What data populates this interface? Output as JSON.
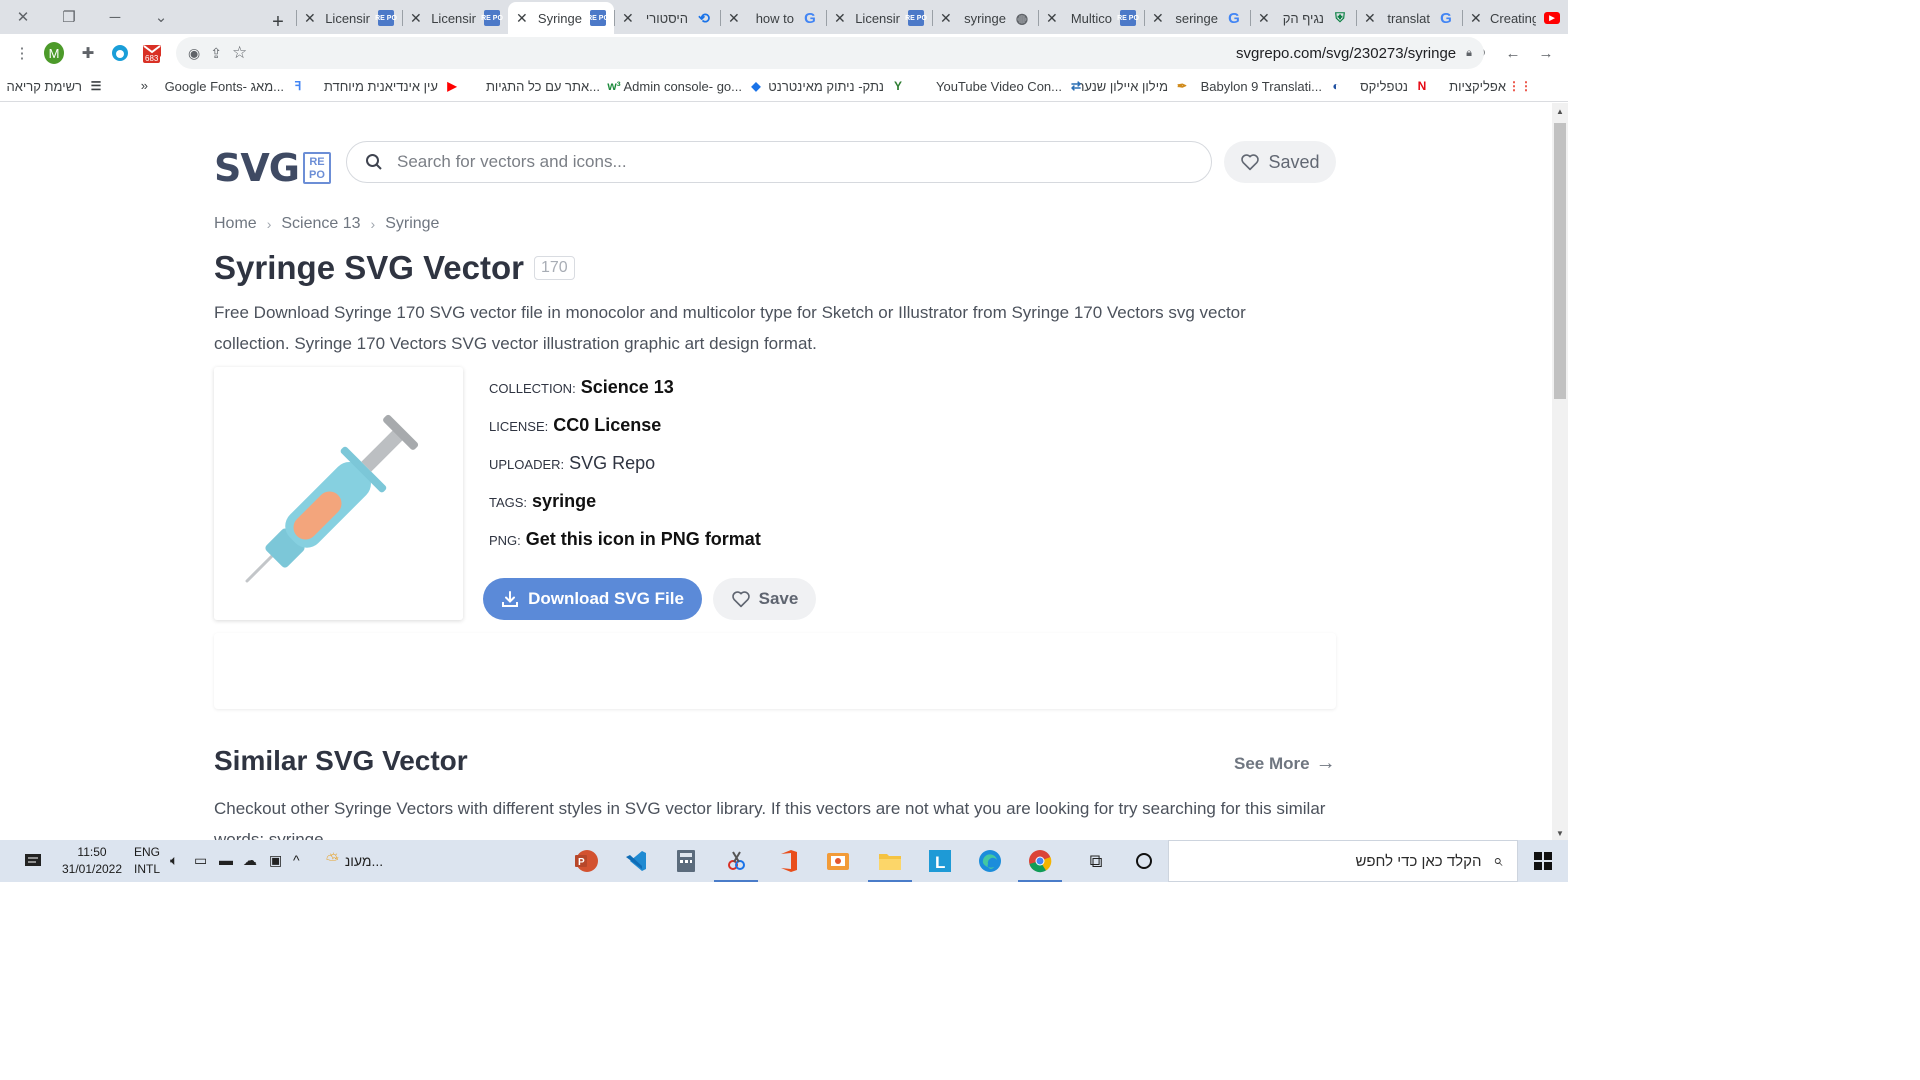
{
  "browser": {
    "tabs": [
      {
        "title": "Creating",
        "icon": "youtube-icon",
        "active": false
      },
      {
        "title": "translat",
        "icon": "google-icon",
        "active": false
      },
      {
        "title": "נגיף הק",
        "icon": "shield-icon",
        "active": false
      },
      {
        "title": "seringe",
        "icon": "google-icon",
        "active": false
      },
      {
        "title": "Multico",
        "icon": "svgrepo-icon",
        "active": false
      },
      {
        "title": "syringe",
        "icon": "globe-icon",
        "active": false
      },
      {
        "title": "Licensir",
        "icon": "svgrepo-icon",
        "active": false
      },
      {
        "title": "how to",
        "icon": "google-icon",
        "active": false
      },
      {
        "title": "היסטורי",
        "icon": "history-icon",
        "active": false
      },
      {
        "title": "Syringe",
        "icon": "svgrepo-icon",
        "active": true
      },
      {
        "title": "Licensir",
        "icon": "svgrepo-icon",
        "active": false
      },
      {
        "title": "Licensir",
        "icon": "svgrepo-icon",
        "active": false
      }
    ],
    "url": "svgrepo.com/svg/230273/syringe",
    "gmail_badge": "683",
    "profile_initial": "M",
    "bookmarks": [
      {
        "label": "אפליקציות",
        "icon": "apps-grid-icon"
      },
      {
        "label": "נטפליקס",
        "icon": "netflix-icon"
      },
      {
        "label": "Babylon 9 Translati...",
        "icon": "babylon-icon"
      },
      {
        "label": "מילון איילון שנער",
        "icon": "feather-icon"
      },
      {
        "label": "YouTube Video Con...",
        "icon": "converter-icon"
      },
      {
        "label": "נתק- ניתוק מאינטרנט",
        "icon": "plug-icon"
      },
      {
        "label": "Admin console- go...",
        "icon": "admin-icon"
      },
      {
        "label": "אתר עם כל התגיות...",
        "icon": "w3-icon"
      },
      {
        "label": "עין אינדיאנית מיוחדת",
        "icon": "youtube-icon"
      },
      {
        "label": "Google Fonts- מאג...",
        "icon": "fonts-icon"
      },
      {
        "label": "»",
        "icon": ""
      },
      {
        "label": "רשימת קריאה",
        "icon": "reading-list-icon"
      }
    ]
  },
  "site": {
    "logo_text": "SVG",
    "logo_badge": "RE PO",
    "search_placeholder": "Search for vectors and icons...",
    "saved_label": "Saved"
  },
  "breadcrumb": [
    "Home",
    "Science 13",
    "Syringe"
  ],
  "page": {
    "title": "Syringe SVG Vector",
    "count": "170",
    "description": "Free Download Syringe 170 SVG vector file in monocolor and multicolor type for Sketch or Illustrator from Syringe 170 Vectors svg vector collection. Syringe 170 Vectors SVG vector illustration graphic art design format."
  },
  "meta": {
    "collection_label": "COLLECTION:",
    "collection_value": "Science 13",
    "license_label": "LICENSE:",
    "license_value": "CC0 License",
    "uploader_label": "UPLOADER:",
    "uploader_value": "SVG Repo",
    "tags_label": "TAGS:",
    "tags_value": "syringe",
    "png_label": "PNG:",
    "png_value": "Get this icon in PNG format"
  },
  "actions": {
    "download_label": "Download SVG File",
    "save_label": "Save"
  },
  "similar": {
    "heading": "Similar SVG Vector",
    "see_more": "See More",
    "text": "Checkout other Syringe Vectors with different styles in SVG vector library. If this vectors are not what you are looking for try searching for this similar words: syringe"
  },
  "taskbar": {
    "search_placeholder": "הקלד כאן כדי לחפש",
    "time": "11:50",
    "date": "31/01/2022",
    "lang1": "ENG",
    "lang2": "INTL",
    "weather": "מעונ..."
  },
  "colors": {
    "accent": "#5b8ad8",
    "title": "#2f3441",
    "syringe_body": "#86d0e0",
    "syringe_liquid": "#f3a57c",
    "taskbar": "#dce4ef"
  }
}
